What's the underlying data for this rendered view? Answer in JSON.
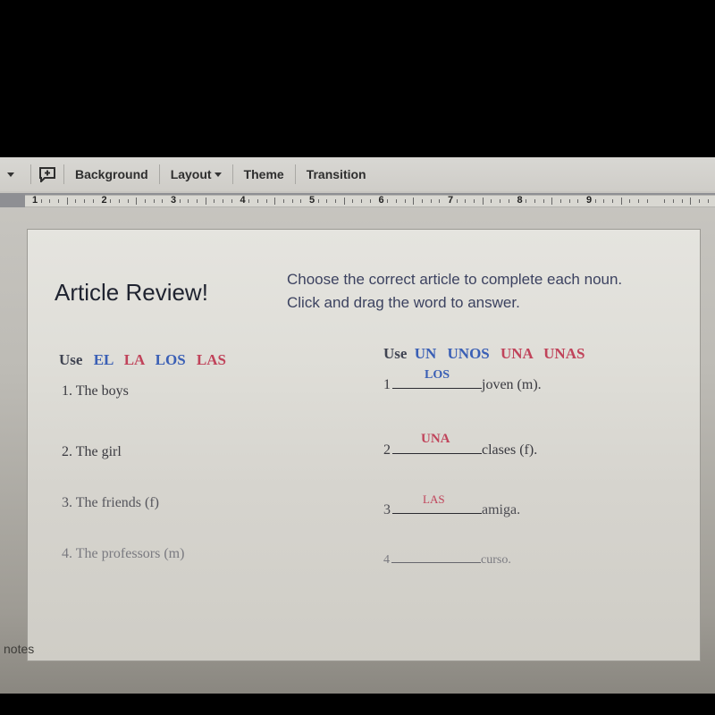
{
  "toolbar": {
    "items": [
      {
        "label": "Background",
        "has_dropdown": false
      },
      {
        "label": "Layout",
        "has_dropdown": true
      },
      {
        "label": "Theme",
        "has_dropdown": false
      },
      {
        "label": "Transition",
        "has_dropdown": false
      }
    ],
    "comment_icon": "add-comment-icon"
  },
  "ruler": {
    "numbers": [
      "1",
      "2",
      "3",
      "4",
      "5",
      "6",
      "7",
      "8",
      "9"
    ]
  },
  "slide": {
    "title": "Article Review!",
    "instructions": "Choose the correct article to complete each noun. Click and drag the word to answer.",
    "colors": {
      "masculine": "#3a5fb5",
      "feminine": "#c0435a"
    },
    "left": {
      "use_label": "Use",
      "articles": [
        {
          "text": "EL",
          "color": "blue"
        },
        {
          "text": "LA",
          "color": "red"
        },
        {
          "text": "LOS",
          "color": "blue"
        },
        {
          "text": "LAS",
          "color": "red"
        }
      ],
      "items": [
        "1. The boys",
        "2. The girl",
        "3. The friends (f)",
        "4. The professors (m)"
      ]
    },
    "right": {
      "use_label": "Use",
      "articles": [
        {
          "text": "UN",
          "color": "blue"
        },
        {
          "text": "UNOS",
          "color": "blue"
        },
        {
          "text": "UNA",
          "color": "red"
        },
        {
          "text": "UNAS",
          "color": "red"
        }
      ],
      "items": [
        {
          "number": "1",
          "noun": "joven (m).",
          "answer": "LOS",
          "answer_color": "blue"
        },
        {
          "number": "2",
          "noun": "clases (f).",
          "answer": "UNA",
          "answer_color": "red"
        },
        {
          "number": "3",
          "noun": "amiga.",
          "answer": "LAS",
          "answer_color": "red"
        },
        {
          "number": "4",
          "noun": "curso.",
          "answer": "",
          "answer_color": ""
        }
      ]
    }
  },
  "notes_label": "notes"
}
